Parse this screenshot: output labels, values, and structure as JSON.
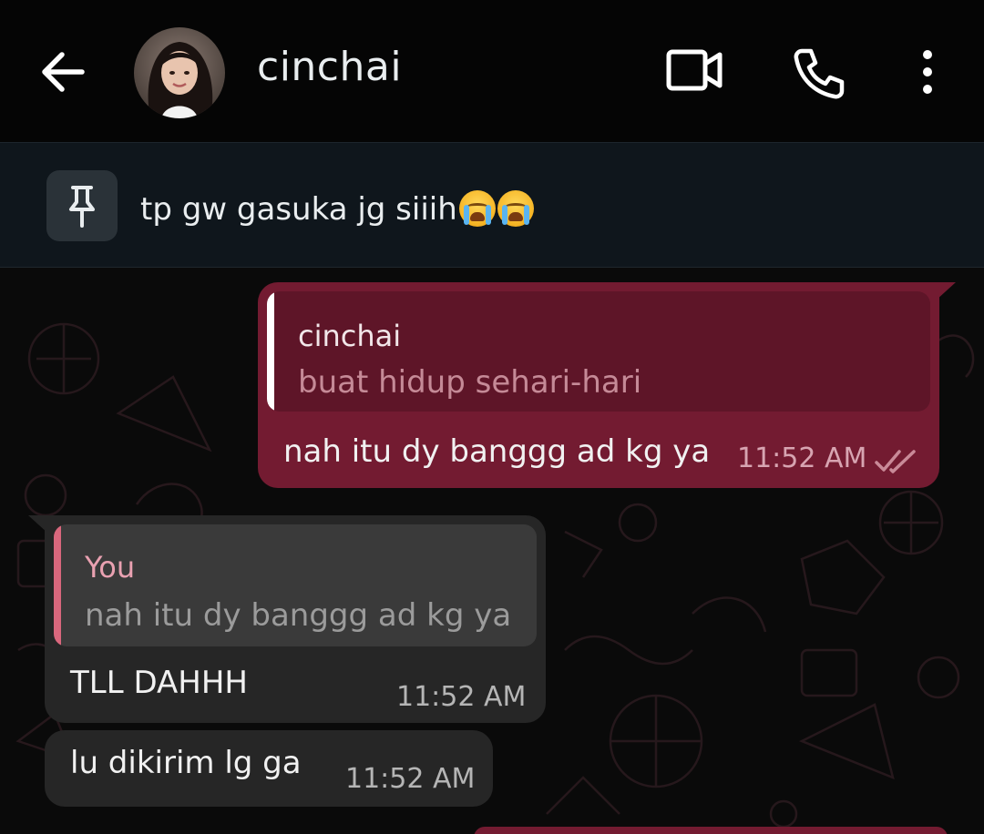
{
  "header": {
    "contact_name": "cinchai",
    "icons": [
      "back-arrow-icon",
      "video-call-icon",
      "phone-icon",
      "more-vert-icon"
    ]
  },
  "pinned": {
    "text": "tp gw gasuka jg siiih",
    "emoji": [
      "loudly-crying-face",
      "loudly-crying-face"
    ]
  },
  "messages": [
    {
      "direction": "outgoing",
      "quote_author": "cinchai",
      "quote_text": "buat hidup sehari-hari",
      "text": "nah itu dy banggg ad kg ya",
      "time": "11:52 AM",
      "status": "read-double-check"
    },
    {
      "direction": "incoming",
      "quote_author": "You",
      "quote_text": "nah itu dy banggg ad kg ya",
      "text": "TLL DAHHH",
      "time": "11:52 AM"
    },
    {
      "direction": "incoming",
      "text": "lu dikirim lg ga",
      "time": "11:52 AM"
    }
  ],
  "colors": {
    "header_bg": "#050505",
    "pinned_bg": "#0f161c",
    "outgoing_bubble": "#731b31",
    "incoming_bubble": "#262626",
    "quote_out_bar": "#ffffff",
    "quote_in_bar": "#d9677d",
    "quote_in_author": "#e9a1b1"
  }
}
